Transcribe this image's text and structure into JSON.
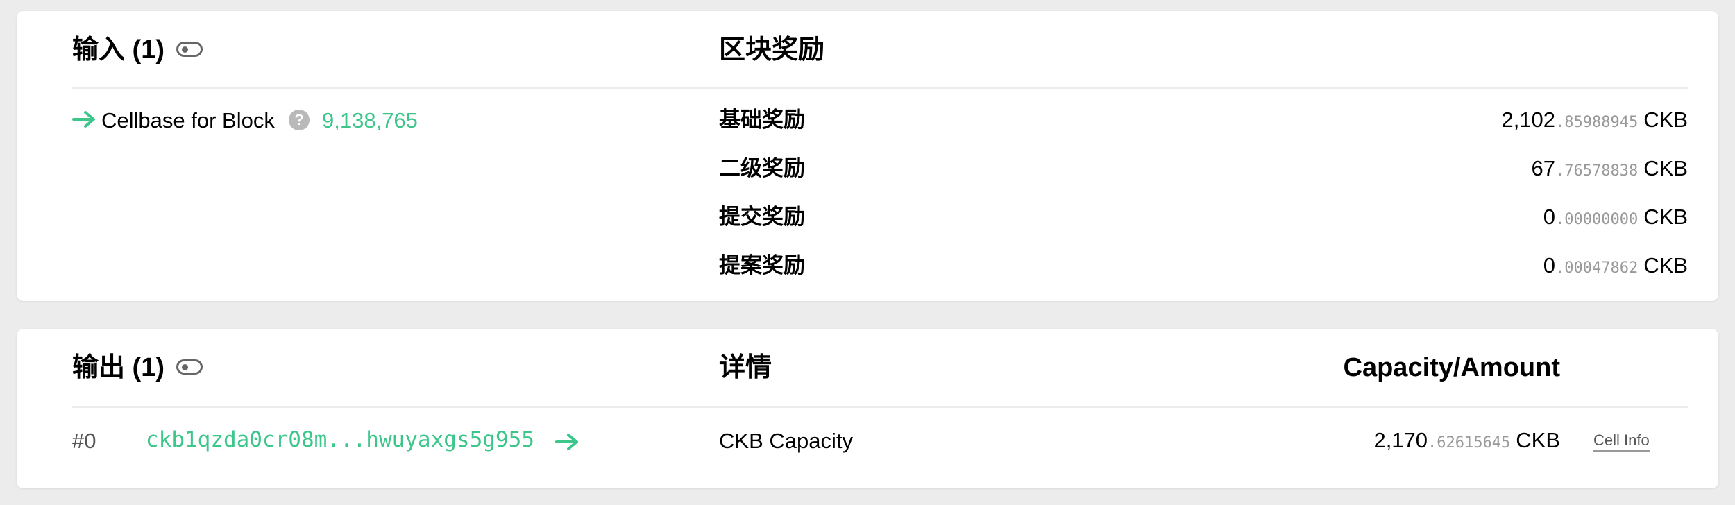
{
  "inputs": {
    "title": "输入 (1)",
    "cellbase_label": "Cellbase for Block",
    "help_symbol": "?",
    "block_number": "9,138,765"
  },
  "rewards": {
    "title": "区块奖励",
    "unit": "CKB",
    "items": [
      {
        "label": "基础奖励",
        "int": "2,102",
        "dec": ".85988945"
      },
      {
        "label": "二级奖励",
        "int": "67",
        "dec": ".76578838"
      },
      {
        "label": "提交奖励",
        "int": "0",
        "dec": ".00000000"
      },
      {
        "label": "提案奖励",
        "int": "0",
        "dec": ".00047862"
      }
    ]
  },
  "outputs": {
    "title": "输出 (1)",
    "details_header": "详情",
    "amount_header": "Capacity/Amount",
    "rows": [
      {
        "index": "#0",
        "address": "ckb1qzda0cr08m...hwuyaxgs5g955",
        "detail": "CKB Capacity",
        "int": "2,170",
        "dec": ".62615645",
        "unit": "CKB",
        "cell_info": "Cell Info"
      }
    ]
  },
  "colors": {
    "accent": "#3cc68a",
    "background": "#ececec",
    "muted": "#999999"
  },
  "icons": {
    "toggle": "toggle-icon",
    "arrow": "arrow-right-icon",
    "help": "question-circle-icon"
  }
}
